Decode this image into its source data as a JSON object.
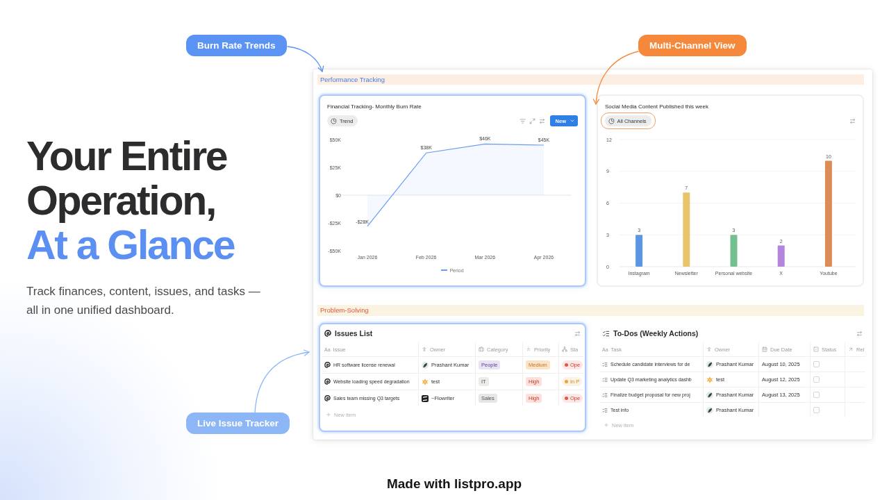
{
  "hero": {
    "headline": "Your Entire Operation,",
    "headline_highlight": "At a Glance",
    "subtitle": "Track finances, content, issues, and tasks — all in one unified dashboard."
  },
  "callouts": [
    {
      "label": "Burn Rate Trends",
      "color": "#5b93f5"
    },
    {
      "label": "Multi-Channel View",
      "color": "#f5883a"
    },
    {
      "label": "Live Issue Tracker",
      "color": "#8db6f7"
    }
  ],
  "dashboard": {
    "performance": {
      "title": "Performance Tracking",
      "burn_rate": {
        "title": "Financial Tracking- Monthly Burn Rate",
        "highlighted": true,
        "view": {
          "label": "Trend",
          "highlighted": false
        },
        "new_button": "New",
        "chart_data": {
          "type": "area",
          "categories": [
            "Jan 2026",
            "Feb 2026",
            "Mar 2026",
            "Apr 2026"
          ],
          "series": [
            {
              "name": "Period",
              "color": "#6b9cf3",
              "values": [
                -28000,
                38000,
                46000,
                45000
              ]
            }
          ],
          "ylim": [
            -50000,
            50000
          ],
          "yticks": [
            {
              "value": 50000,
              "label": "$50K"
            },
            {
              "value": 25000,
              "label": "$25K"
            },
            {
              "value": 0,
              "label": "$0"
            },
            {
              "value": -25000,
              "label": "-$25K"
            },
            {
              "value": -50000,
              "label": "-$50K"
            }
          ],
          "value_labels": [
            "-$28K",
            "$38K",
            "$46K",
            "$45K"
          ]
        }
      },
      "social": {
        "title": "Social Media Content Published this week",
        "highlighted": false,
        "view": {
          "label": "All Channels",
          "highlighted": true
        },
        "chart_data": {
          "type": "bar",
          "categories": [
            "Instagram",
            "Newsletter",
            "Personal website",
            "X",
            "Youtube"
          ],
          "values": [
            3,
            7,
            3,
            2,
            10
          ],
          "colors": [
            "#5b95e6",
            "#e8c46a",
            "#74bf8f",
            "#b584dc",
            "#dc8c57"
          ],
          "ylim": [
            0,
            12
          ],
          "yticks": [
            0,
            3,
            6,
            9,
            12
          ],
          "grid": true,
          "data_labels": true
        }
      }
    },
    "problem_solving": {
      "title": "Problem-Solving",
      "issues": {
        "title": "Issues List",
        "highlighted": true,
        "columns": [
          {
            "kind": "title",
            "icon_text": "Aa",
            "label": "Issue"
          },
          {
            "kind": "person",
            "label": "Owner"
          },
          {
            "kind": "select",
            "label": "Category"
          },
          {
            "kind": "priority",
            "label": "Priority"
          },
          {
            "kind": "status",
            "label": "Sta"
          }
        ],
        "rows": [
          {
            "issue": "HR software license renewal",
            "owner": {
              "name": "Prashant Kumar",
              "kind": "circle"
            },
            "category": {
              "label": "People",
              "color": "#e9e4f3"
            },
            "priority": {
              "label": "Medium",
              "color": "#fbe3c8"
            },
            "status": {
              "label": "Ope",
              "color": "#e4574a"
            }
          },
          {
            "issue": "Website loading speed degradation",
            "owner": {
              "name": "test",
              "kind": "burst"
            },
            "category": {
              "label": "IT",
              "color": "#ececeb"
            },
            "priority": {
              "label": "High",
              "color": "#fde0dc"
            },
            "status": {
              "label": "In P",
              "color": "#e9a33b"
            }
          },
          {
            "issue": "Sales team missing Q3 targets",
            "owner": {
              "name": "~Flowriter",
              "kind": "square"
            },
            "category": {
              "label": "Sales",
              "color": "#e6e6e5"
            },
            "priority": {
              "label": "High",
              "color": "#fde0dc"
            },
            "status": {
              "label": "Ope",
              "color": "#e4574a"
            }
          }
        ],
        "new_item": "New item"
      },
      "todos": {
        "title": "To-Dos (Weekly Actions)",
        "columns": [
          {
            "kind": "title",
            "icon_text": "Aa",
            "label": "Task"
          },
          {
            "kind": "person",
            "label": "Owner"
          },
          {
            "kind": "date",
            "label": "Due Date"
          },
          {
            "kind": "checkbox",
            "label": "Status"
          },
          {
            "kind": "relation",
            "label": "Rel"
          }
        ],
        "rows": [
          {
            "task": "Schedule candidate interviews for de",
            "owner": {
              "name": "Prashant Kumar",
              "kind": "circle"
            },
            "due": "August 10, 2025",
            "done": false
          },
          {
            "task": "Update Q3 marketing analytics dashb",
            "owner": {
              "name": "test",
              "kind": "burst"
            },
            "due": "August 12, 2025",
            "done": false
          },
          {
            "task": "Finalize budget proposal for new proj",
            "owner": {
              "name": "Prashant Kumar",
              "kind": "circle"
            },
            "due": "August 13, 2025",
            "done": false
          },
          {
            "task": "Test info",
            "owner": {
              "name": "Prashant Kumar",
              "kind": "circle"
            },
            "done": false
          }
        ],
        "new_item": "New item"
      }
    }
  },
  "footer": "Made with listpro.app"
}
